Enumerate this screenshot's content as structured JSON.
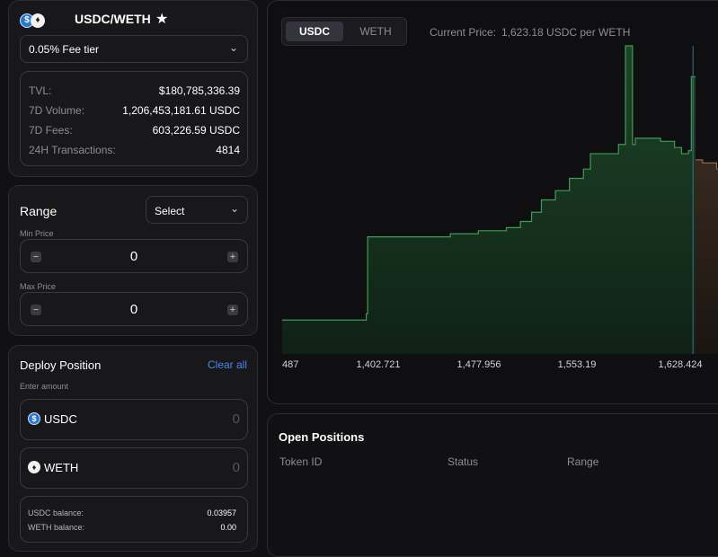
{
  "pool": {
    "pair": "USDC/WETH",
    "fee_tier": "0.05% Fee tier",
    "stats": [
      {
        "label": "TVL:",
        "value": "$180,785,336.39"
      },
      {
        "label": "7D Volume:",
        "value": "1,206,453,181.61 USDC"
      },
      {
        "label": "7D Fees:",
        "value": "603,226.59 USDC"
      },
      {
        "label": "24H Transactions:",
        "value": "4814"
      }
    ]
  },
  "range": {
    "title": "Range",
    "select_label": "Select",
    "min_label": "Min Price",
    "min_value": "0",
    "max_label": "Max Price",
    "max_value": "0",
    "minus": "−",
    "plus": "+"
  },
  "deploy": {
    "title": "Deploy Position",
    "clear_all": "Clear all",
    "enter_amount": "Enter amount",
    "usdc_label": "USDC",
    "usdc_value": "0",
    "weth_label": "WETH",
    "weth_value": "0",
    "usdc_balance_label": "USDC balance:",
    "usdc_balance": "0.03957",
    "weth_balance_label": "WETH balance:",
    "weth_balance": "0.00"
  },
  "chart": {
    "tabs": [
      "USDC",
      "WETH"
    ],
    "active_tab": "USDC",
    "price_label": "Current Price:",
    "price_value": "1,623.18 USDC per WETH"
  },
  "positions": {
    "title": "Open Positions",
    "columns": [
      "Token ID",
      "Status",
      "Range"
    ]
  },
  "colors": {
    "green": "#3f9c54",
    "orange": "#8b6a4a",
    "current_price_line": "#4a6a8a",
    "link": "#4a88e8"
  },
  "chart_data": {
    "type": "area",
    "title": "",
    "xlabel": "",
    "ylabel": "",
    "x_tick_labels": [
      "487",
      "1,402.721",
      "1,477.956",
      "1,553.19",
      "1,628.424"
    ],
    "current_price": 1623.18,
    "x": [
      1330,
      1390,
      1391,
      1450,
      1470,
      1490,
      1500,
      1508,
      1515,
      1525,
      1535,
      1545,
      1550,
      1560,
      1570,
      1575,
      1580,
      1582,
      1590,
      1600,
      1610,
      1615,
      1620,
      1622,
      1625,
      1630,
      1640,
      1650
    ],
    "values": [
      0.11,
      0.13,
      0.38,
      0.39,
      0.4,
      0.41,
      0.43,
      0.46,
      0.5,
      0.53,
      0.57,
      0.6,
      0.65,
      0.65,
      0.68,
      1.0,
      0.68,
      0.7,
      0.7,
      0.69,
      0.67,
      0.65,
      0.66,
      0.9,
      0.63,
      0.62,
      0.6,
      0.58
    ],
    "ylim": [
      0,
      1.0
    ]
  }
}
